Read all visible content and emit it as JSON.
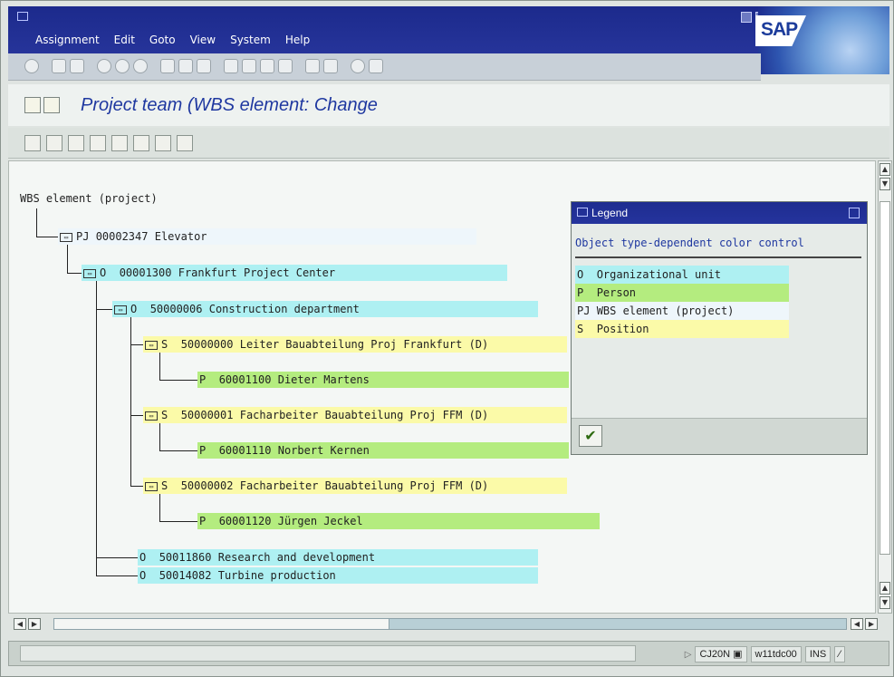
{
  "menu": [
    "Assignment",
    "Edit",
    "Goto",
    "View",
    "System",
    "Help"
  ],
  "logo": "SAP",
  "title": "Project team (WBS element: Change",
  "tree": {
    "root_label": "WBS element (project)",
    "n1": {
      "type": "PJ",
      "id": "00002347",
      "name": "Elevator"
    },
    "n2": {
      "type": "O",
      "id": "00001300",
      "name": "Frankfurt Project Center"
    },
    "n3": {
      "type": "O",
      "id": "50000006",
      "name": "Construction department"
    },
    "n4": {
      "type": "S",
      "id": "50000000",
      "name": "Leiter Bauabteilung Proj Frankfurt (D)"
    },
    "n5": {
      "type": "P",
      "id": "60001100",
      "name": "Dieter Martens"
    },
    "n6": {
      "type": "S",
      "id": "50000001",
      "name": "Facharbeiter Bauabteilung Proj FFM (D)"
    },
    "n7": {
      "type": "P",
      "id": "60001110",
      "name": "Norbert Kernen"
    },
    "n8": {
      "type": "S",
      "id": "50000002",
      "name": "Facharbeiter Bauabteilung Proj FFM (D)"
    },
    "n9": {
      "type": "P",
      "id": "60001120",
      "name": "Jürgen Jeckel"
    },
    "n10": {
      "type": "O",
      "id": "50011860",
      "name": "Research and development"
    },
    "n11": {
      "type": "O",
      "id": "50014082",
      "name": "Turbine production"
    }
  },
  "legend": {
    "title": "Legend",
    "subtitle": "Object type-dependent color control",
    "items": [
      {
        "code": "O",
        "label": "Organizational unit"
      },
      {
        "code": "P",
        "label": "Person"
      },
      {
        "code": "PJ",
        "label": "WBS element (project)"
      },
      {
        "code": "S",
        "label": "Position"
      }
    ]
  },
  "status": {
    "transaction": "CJ20N",
    "server": "w11tdc00",
    "mode": "INS"
  },
  "colors": {
    "org": "#aef0f2",
    "person": "#b4ec7f",
    "wbs": "#eef6fb",
    "position": "#fbfaa8",
    "titlebar": "#1c2a8c"
  }
}
